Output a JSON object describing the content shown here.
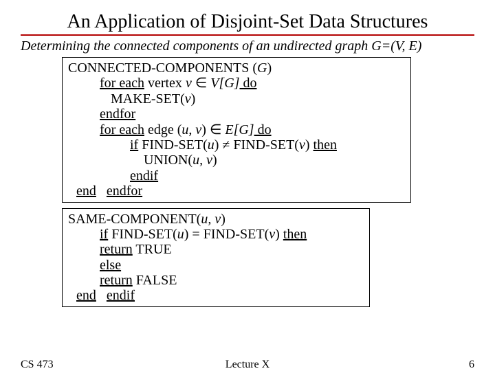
{
  "title": "An Application of Disjoint-Set Data Structures",
  "subtitle_prefix": "Determining the connected components of an undirected graph ",
  "subtitle_graph": "G=(V, E)",
  "box1": {
    "header": "CONNECTED-COMPONENTS (",
    "header_arg": "G",
    "header_close": ")",
    "l1_a": "for each",
    "l1_b": " vertex ",
    "l1_v": "v",
    "l1_in": " ∈ ",
    "l1_set": "V[G]",
    "l1_do": " do",
    "l2_a": "MAKE-SET(",
    "l2_v": "v",
    "l2_b": ")",
    "l3": "endfor",
    "l4_a": "for each",
    "l4_b": " edge (",
    "l4_u": "u",
    "l4_c": ", ",
    "l4_v": "v",
    "l4_d": ")",
    "l4_in": " ∈ ",
    "l4_set": "E[G]",
    "l4_do": " do",
    "l5_a": "if",
    "l5_b": "  FIND-SET(",
    "l5_u": "u",
    "l5_c": ")  ≠  FIND-SET(",
    "l5_v": "v",
    "l5_d": ") ",
    "l5_then": "then",
    "l6_a": "UNION(",
    "l6_u": "u",
    "l6_c": ", ",
    "l6_v": "v",
    "l6_b": ")",
    "l7": "endif",
    "l8": "endfor",
    "end": "end"
  },
  "box2": {
    "header": "SAME-COMPONENT(",
    "header_u": "u",
    "header_c": ", ",
    "header_v": "v",
    "header_close": ")",
    "l1_a": "if",
    "l1_b": " FIND-SET(",
    "l1_u": "u",
    "l1_c": ") = FIND-SET(",
    "l1_v": "v",
    "l1_d": ") ",
    "l1_then": "then",
    "l2_a": "return",
    "l2_b": " TRUE",
    "l3": "else",
    "l4_a": "return",
    "l4_b": " FALSE",
    "l5": "endif",
    "end": "end"
  },
  "footer": {
    "left": "CS 473",
    "center": "Lecture X",
    "right": "6"
  }
}
